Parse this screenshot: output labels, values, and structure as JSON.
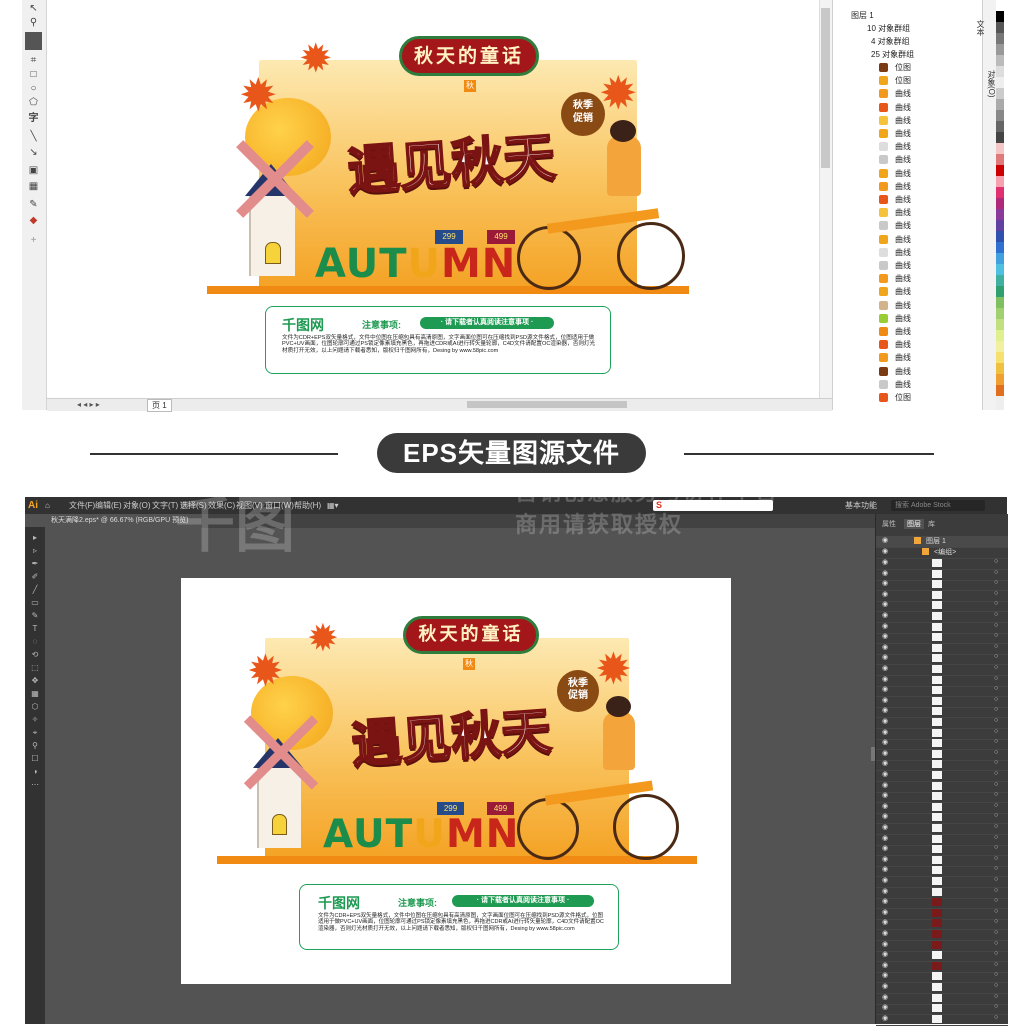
{
  "poster": {
    "top_title": "秋天的童话",
    "main_title": "遇见秋天",
    "autumn_word": "AUTUMN",
    "bubble_line1": "秋季",
    "bubble_line2": "促销",
    "center_badge": "秋",
    "price1": "299",
    "price2": "499"
  },
  "notice": {
    "logo": "千图网",
    "title": "注意事项:",
    "pill": "· 请下载者认真阅读注意事项 ·",
    "body": "文件为CDR+EPS双矢量格式，文件中位图在压缩包具有高清原图，文字画面位图可在压缩找到PSD源文件格式，位图适用于做PVC+UV画面，位图轮廓可通过PS锁定像素填充黑色，再拖进CDR或AI进行转矢量轮廓，C4D文件请配置OC渲染器，否则灯光材质打开无效，以上问题请下载者悉知，版权归千图网所有，Desing by www.58pic.com"
  },
  "corel": {
    "page_tab": "页 1",
    "objects": {
      "layer": "图层 1",
      "group1": "10 对象群组",
      "group2": "4 对象群组",
      "group3": "25 对象群组",
      "bitmap": "位图",
      "curve": "曲线"
    },
    "dock_tabs": [
      "对象(O)",
      "文本"
    ]
  },
  "divider_label": "EPS矢量图源文件",
  "illustrator": {
    "logo": "Ai",
    "menus": [
      "文件(F)",
      "编辑(E)",
      "对象(O)",
      "文字(T)",
      "选择(S)",
      "效果(C)",
      "视图(V)",
      "窗口(W)",
      "帮助(H)"
    ],
    "workspace": "基本功能",
    "search_placeholder": "搜索 Adobe Stock",
    "doc_tab": "秋天满降2.eps* @ 66.67% (RGB/GPU 预览)",
    "panel_tabs": [
      "属性",
      "图层",
      "库"
    ],
    "layer_name": "图层 1",
    "sublayer_name": "<编组>"
  },
  "watermark": {
    "logo": "千图",
    "line1": "营销创意服务与协作平台",
    "line2": "商用请获取授权"
  },
  "colors": {
    "orange": "#f08a12",
    "deep_red": "#a3161a",
    "green": "#1f9a52",
    "ai_dark": "#535353"
  }
}
